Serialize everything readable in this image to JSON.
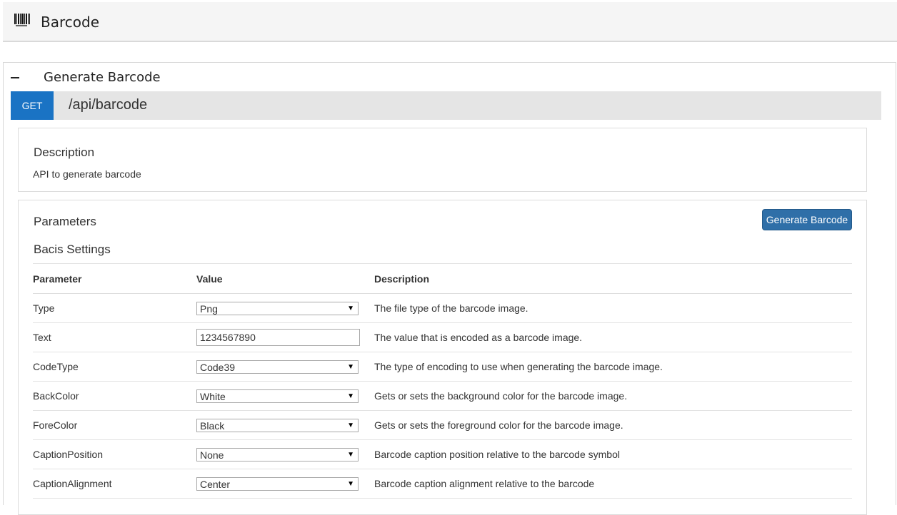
{
  "header": {
    "title": "Barcode",
    "icon": "barcode-icon"
  },
  "section": {
    "title": "Generate Barcode",
    "collapse_icon": "minus-icon"
  },
  "endpoint": {
    "method": "GET",
    "path": "/api/barcode",
    "method_color": "#1a73c4"
  },
  "description": {
    "heading": "Description",
    "text": "API to generate barcode"
  },
  "parameters": {
    "heading": "Parameters",
    "subheading": "Bacis Settings",
    "button_label": "Generate Barcode",
    "columns": [
      "Parameter",
      "Value",
      "Description"
    ],
    "rows": [
      {
        "name": "Type",
        "value": "Png",
        "control": "select",
        "description": "The file type of the barcode image."
      },
      {
        "name": "Text",
        "value": "1234567890",
        "control": "text",
        "description": "The value that is encoded as a barcode image."
      },
      {
        "name": "CodeType",
        "value": "Code39",
        "control": "select",
        "description": "The type of encoding to use when generating the barcode image."
      },
      {
        "name": "BackColor",
        "value": "White",
        "control": "select",
        "description": "Gets or sets the background color for the barcode image."
      },
      {
        "name": "ForeColor",
        "value": "Black",
        "control": "select",
        "description": "Gets or sets the foreground color for the barcode image."
      },
      {
        "name": "CaptionPosition",
        "value": "None",
        "control": "select",
        "description": "Barcode caption position relative to the barcode symbol"
      },
      {
        "name": "CaptionAlignment",
        "value": "Center",
        "control": "select",
        "description": "Barcode caption alignment relative to the barcode"
      }
    ]
  },
  "colors": {
    "button_bg": "#2f6fa8",
    "endpoint_bg": "#e5e5e5",
    "header_bg": "#f5f5f5"
  }
}
